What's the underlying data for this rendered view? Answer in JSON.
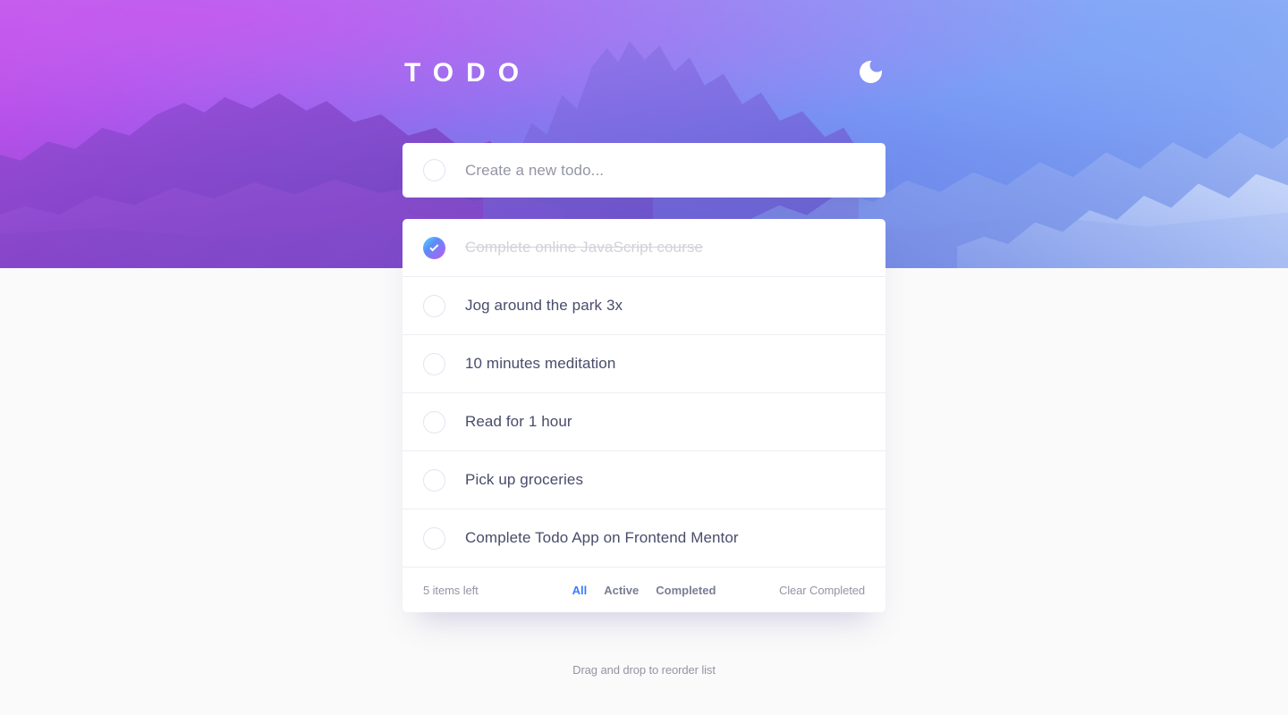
{
  "header": {
    "title": "TODO",
    "theme_toggle_icon": "moon-icon"
  },
  "new_todo": {
    "value": "",
    "placeholder": "Create a new todo...",
    "checkbox_icon": "circle-outline-icon"
  },
  "todos": [
    {
      "label": "Complete online JavaScript course",
      "completed": true
    },
    {
      "label": "Jog around the park 3x",
      "completed": false
    },
    {
      "label": "10 minutes meditation",
      "completed": false
    },
    {
      "label": "Read for 1 hour",
      "completed": false
    },
    {
      "label": "Pick up groceries",
      "completed": false
    },
    {
      "label": "Complete Todo App on Frontend Mentor",
      "completed": false
    }
  ],
  "footer": {
    "items_left": "5 items left",
    "filters": [
      {
        "label": "All",
        "active": true
      },
      {
        "label": "Active",
        "active": false
      },
      {
        "label": "Completed",
        "active": false
      }
    ],
    "clear_completed": "Clear Completed"
  },
  "hint": "Drag and drop to reorder list",
  "colors": {
    "accent_blue": "#3A7CFD",
    "check_gradient_start": "#55DDFF",
    "check_gradient_end": "#C058F3",
    "text_dark": "#494C6B",
    "text_muted": "#9495A5",
    "text_completed": "#D1D2DA",
    "page_background": "#FAFAFA",
    "card_background": "#FFFFFF"
  }
}
